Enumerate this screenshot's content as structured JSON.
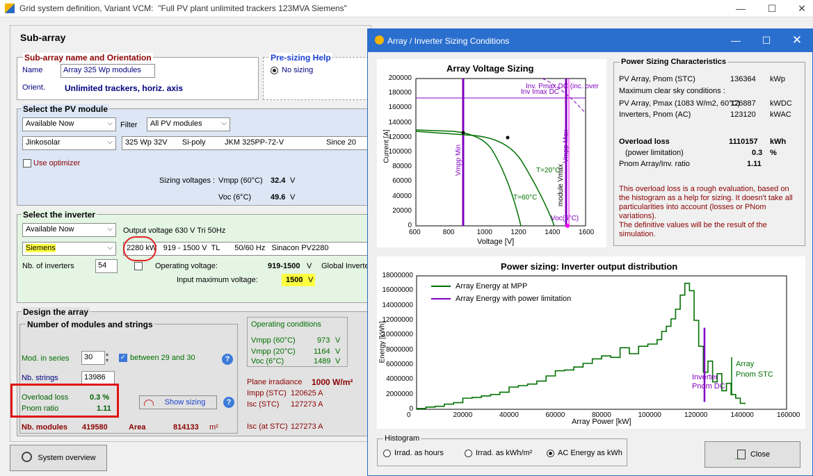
{
  "main": {
    "title": "Grid system definition, Variant VCM:  \"Full PV plant unlimited trackers 123MVA Siemens\"",
    "subarray_header": "Sub-array",
    "name_orientation": {
      "title": "Sub-array name and Orientation",
      "name_label": "Name",
      "name_value": "Array 325 Wp modules",
      "orient_label": "Orient.",
      "orient_value": "Unlimited trackers, horiz. axis"
    },
    "presizing": {
      "title": "Pre-sizing Help",
      "option": "No sizing"
    },
    "pv_module": {
      "title": "Select the PV module",
      "availability": "Available Now",
      "filter_label": "Filter",
      "filter_value": "All PV modules",
      "manufacturer": "Jinkosolar",
      "module": "325 Wp 32V       Si-poly         JKM 325PP-72-V                    Since 20",
      "optimizer": "Use optimizer",
      "sizing_label": "Sizing voltages :",
      "vmpp_label": "Vmpp (60°C)",
      "vmpp_value": "32.4",
      "voc_label": "Voc (6°C)",
      "voc_value": "49.6",
      "unit_v": "V"
    },
    "inverter": {
      "title": "Select the inverter",
      "availability": "Available Now",
      "output_voltage": "Output voltage 630 V Tri 50Hz",
      "manufacturer": "Siemens",
      "model": "2280 kW   919 - 1500 V  TL       50/60 Hz   Sinacon PV2280",
      "nb_label": "Nb. of inverters",
      "nb_value": "54",
      "op_voltage_label": "Operating voltage:",
      "op_voltage_value": "919-1500",
      "global_label": "Global Inverte",
      "input_max_label": "Input maximum voltage:",
      "input_max_value": "1500",
      "unit_v": "V"
    },
    "design": {
      "title": "Design the array",
      "subtitle": "Number of modules and strings",
      "mod_series_label": "Mod. in series",
      "mod_series_value": "30",
      "between": "between 29 and 30",
      "nb_strings_label": "Nb. strings",
      "nb_strings_value": "13986",
      "overload_label": "Overload loss",
      "overload_value": "0.3 %",
      "pnom_label": "Pnom ratio",
      "pnom_value": "1.11",
      "show_sizing": "Show sizing",
      "nb_modules_label": "Nb. modules",
      "nb_modules_value": "419580",
      "area_label": "Area",
      "area_value": "814133",
      "area_unit": "m²"
    },
    "operating": {
      "title": "Operating conditions",
      "rows": [
        {
          "label": "Vmpp (60°C)",
          "value": "973",
          "unit": "V"
        },
        {
          "label": "Vmpp (20°C)",
          "value": "1164",
          "unit": "V"
        },
        {
          "label": "Voc (6°C)",
          "value": "1489",
          "unit": "V"
        }
      ]
    },
    "irradiance": {
      "plane_label": "Plane irradiance",
      "plane_value": "1000 W/m²",
      "impp_label": "Impp (STC)",
      "impp_value": "120625 A",
      "isc_label": "Isc (STC)",
      "isc_value": "127273 A",
      "isc_at_label": "Isc (at STC)",
      "isc_at_value": "127273 A"
    },
    "system_overview": "System overview"
  },
  "dialog": {
    "title": "Array / Inverter Sizing Conditions",
    "voltage_chart": {
      "title": "Array Voltage Sizing",
      "xlabel": "Voltage [V]",
      "ylabel": "Current [A]",
      "xticks": [
        "600",
        "800",
        "1000",
        "1200",
        "1400",
        "1600"
      ],
      "yticks": [
        "0",
        "20000",
        "40000",
        "60000",
        "80000",
        "100000",
        "120000",
        "140000",
        "160000",
        "180000",
        "200000"
      ],
      "labels": {
        "pmax": "Inv. Pmax DC (inc. over",
        "imax": "Inv Imax DC",
        "vmpp_min": "Vmpp Min",
        "vmpp_max": "Vmpp Max",
        "module_vmax": "module Vmax",
        "t20": "T=20°C",
        "t60": "T=60°C",
        "voc6": "Voc(6°C)"
      }
    },
    "chart_data": {
      "type": "line",
      "title": "Power sizing: Inverter output distribution",
      "xlabel": "Array Power [kW]",
      "ylabel": "Energy [kWh]",
      "xlim": [
        0,
        160000
      ],
      "ylim": [
        0,
        18000000
      ],
      "xticks": [
        "0",
        "20000",
        "40000",
        "60000",
        "80000",
        "100000",
        "120000",
        "140000",
        "160000"
      ],
      "yticks": [
        "0",
        "2000000",
        "4000000",
        "6000000",
        "8000000",
        "10000000",
        "12000000",
        "14000000",
        "16000000",
        "18000000"
      ],
      "series": [
        {
          "name": "Array Energy at MPP",
          "color": "#007000",
          "x": [
            0,
            4000,
            8000,
            12000,
            16000,
            20000,
            24000,
            28000,
            32000,
            36000,
            40000,
            44000,
            48000,
            52000,
            56000,
            60000,
            64000,
            68000,
            72000,
            76000,
            80000,
            84000,
            88000,
            92000,
            96000,
            100000,
            104000,
            106000,
            108000,
            110000,
            112000,
            114000,
            116000,
            118000,
            120000,
            122000,
            124000,
            126000,
            128000,
            130000,
            132000,
            134000,
            136000,
            138000,
            140000,
            142000
          ],
          "values": [
            100000,
            300000,
            400000,
            700000,
            900000,
            1500000,
            1600000,
            1800000,
            2000000,
            2300000,
            3000000,
            3200000,
            3400000,
            3800000,
            4500000,
            5200000,
            5300000,
            5700000,
            6200000,
            6800000,
            7200000,
            7000000,
            8300000,
            7500000,
            8500000,
            8800000,
            9400000,
            10500000,
            11200000,
            12200000,
            13500000,
            15400000,
            17000000,
            16000000,
            12000000,
            8500000,
            5000000,
            6500000,
            3700000,
            4800000,
            2500000,
            3500000,
            2000000,
            1500000,
            800000,
            700000
          ]
        },
        {
          "name": "Array Energy with power limitation",
          "color": "#8000c0",
          "x": [
            124500,
            124500
          ],
          "values": [
            1000000,
            11000000
          ]
        }
      ],
      "annotations": [
        "Inverter Pnom DC",
        "Array Pnom STC"
      ]
    },
    "characteristics": {
      "title": "Power Sizing Characteristics",
      "pv_pnom_label": "PV Array, Pnom (STC)",
      "pv_pnom_value": "136364",
      "pv_pnom_unit": "kWp",
      "clear_sky_label": "Maximum clear sky conditions :",
      "pv_pmax_label": "PV Array, Pmax (1083 W/m2, 60°C)",
      "pv_pmax_value": "126887",
      "pv_pmax_unit": "kWDC",
      "inv_pnom_label": "Inverters, Pnom (AC)",
      "inv_pnom_value": "123120",
      "inv_pnom_unit": "kWAC",
      "overload_label": "Overload loss",
      "overload_value": "1110157",
      "overload_unit": "kWh",
      "power_lim_label": "(power limitation)",
      "power_lim_value": "0.3",
      "power_lim_unit": "%",
      "ratio_label": "Pnom Array/Inv. ratio",
      "ratio_value": "1.11",
      "note": "This overload loss is a rough evaluation, based on the histogram as a help for sizing. It doesn't take all particularities into account (losses or PNom variations).\nThe definitive values will be the result of the simulation."
    },
    "histogram": {
      "title": "Histogram",
      "options": [
        "Irrad. as hours",
        "Irrad. as kWh/m²",
        "AC Energy as kWh"
      ],
      "selected": 2
    },
    "close": "Close"
  }
}
